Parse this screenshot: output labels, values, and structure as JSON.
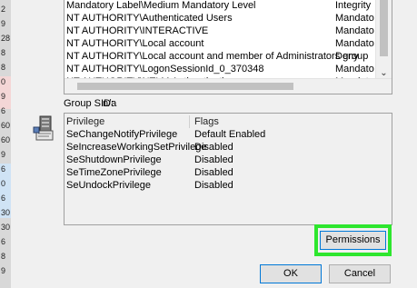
{
  "left_strip": {
    "numbers": [
      "2",
      "9",
      "28",
      "8",
      "8",
      "0",
      "9",
      "6",
      "60",
      "60",
      "9",
      "6",
      "0",
      "6",
      "30",
      "30",
      "6",
      "8",
      "9"
    ]
  },
  "groups_list": {
    "rows": [
      {
        "name": "Mandatory Label\\Medium Mandatory Level",
        "attr": "Integrity"
      },
      {
        "name": "NT AUTHORITY\\Authenticated Users",
        "attr": "Mandato"
      },
      {
        "name": "NT AUTHORITY\\INTERACTIVE",
        "attr": "Mandato"
      },
      {
        "name": "NT AUTHORITY\\Local account",
        "attr": "Mandato"
      },
      {
        "name": "NT AUTHORITY\\Local account and member of Administrators group",
        "attr": "Deny"
      },
      {
        "name": "NT AUTHORITY\\LogonSessionId_0_370348",
        "attr": "Mandato"
      },
      {
        "name": "NT AUTHORITY\\NTLM Authentication",
        "attr": "Mandato"
      }
    ]
  },
  "group_sid": {
    "label": "Group SID:",
    "value": "n/a"
  },
  "privileges": {
    "col_privilege": "Privilege",
    "col_flags": "Flags",
    "rows": [
      {
        "name": "SeChangeNotifyPrivilege",
        "flags": "Default Enabled"
      },
      {
        "name": "SeIncreaseWorkingSetPrivilege",
        "flags": "Disabled"
      },
      {
        "name": "SeShutdownPrivilege",
        "flags": "Disabled"
      },
      {
        "name": "SeTimeZonePrivilege",
        "flags": "Disabled"
      },
      {
        "name": "SeUndockPrivilege",
        "flags": "Disabled"
      }
    ]
  },
  "buttons": {
    "permissions": "Permissions",
    "ok": "OK",
    "cancel": "Cancel"
  },
  "colors": {
    "highlight": "#2ee62e",
    "accent_border": "#0078d7"
  }
}
